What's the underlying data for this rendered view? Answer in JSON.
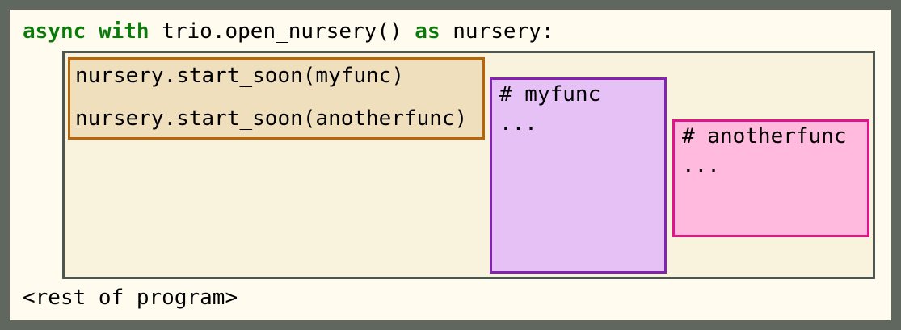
{
  "header": {
    "kw_async": "async",
    "kw_with": "with",
    "call": "trio.open_nursery()",
    "kw_as": "as",
    "target": "nursery:"
  },
  "parent_task": {
    "line1": "nursery.start_soon(myfunc)",
    "line2": "nursery.start_soon(anotherfunc)"
  },
  "task_myfunc": {
    "comment": "# myfunc",
    "body": "..."
  },
  "task_anotherfunc": {
    "comment": "# anotherfunc",
    "body": "..."
  },
  "footer": {
    "rest": "<rest of program>"
  },
  "colors": {
    "frame": "#5f675e",
    "background": "#fffcef",
    "keyword": "#0b7a0b",
    "nursery_fill": "#f9f2dc",
    "nursery_border": "#4e5650",
    "parent_fill": "#f0dfbd",
    "parent_border": "#b8650a",
    "myfunc_fill": "#e6c1f5",
    "myfunc_border": "#8423b0",
    "anotherfunc_fill": "#ffbadd",
    "anotherfunc_border": "#e0158a"
  }
}
